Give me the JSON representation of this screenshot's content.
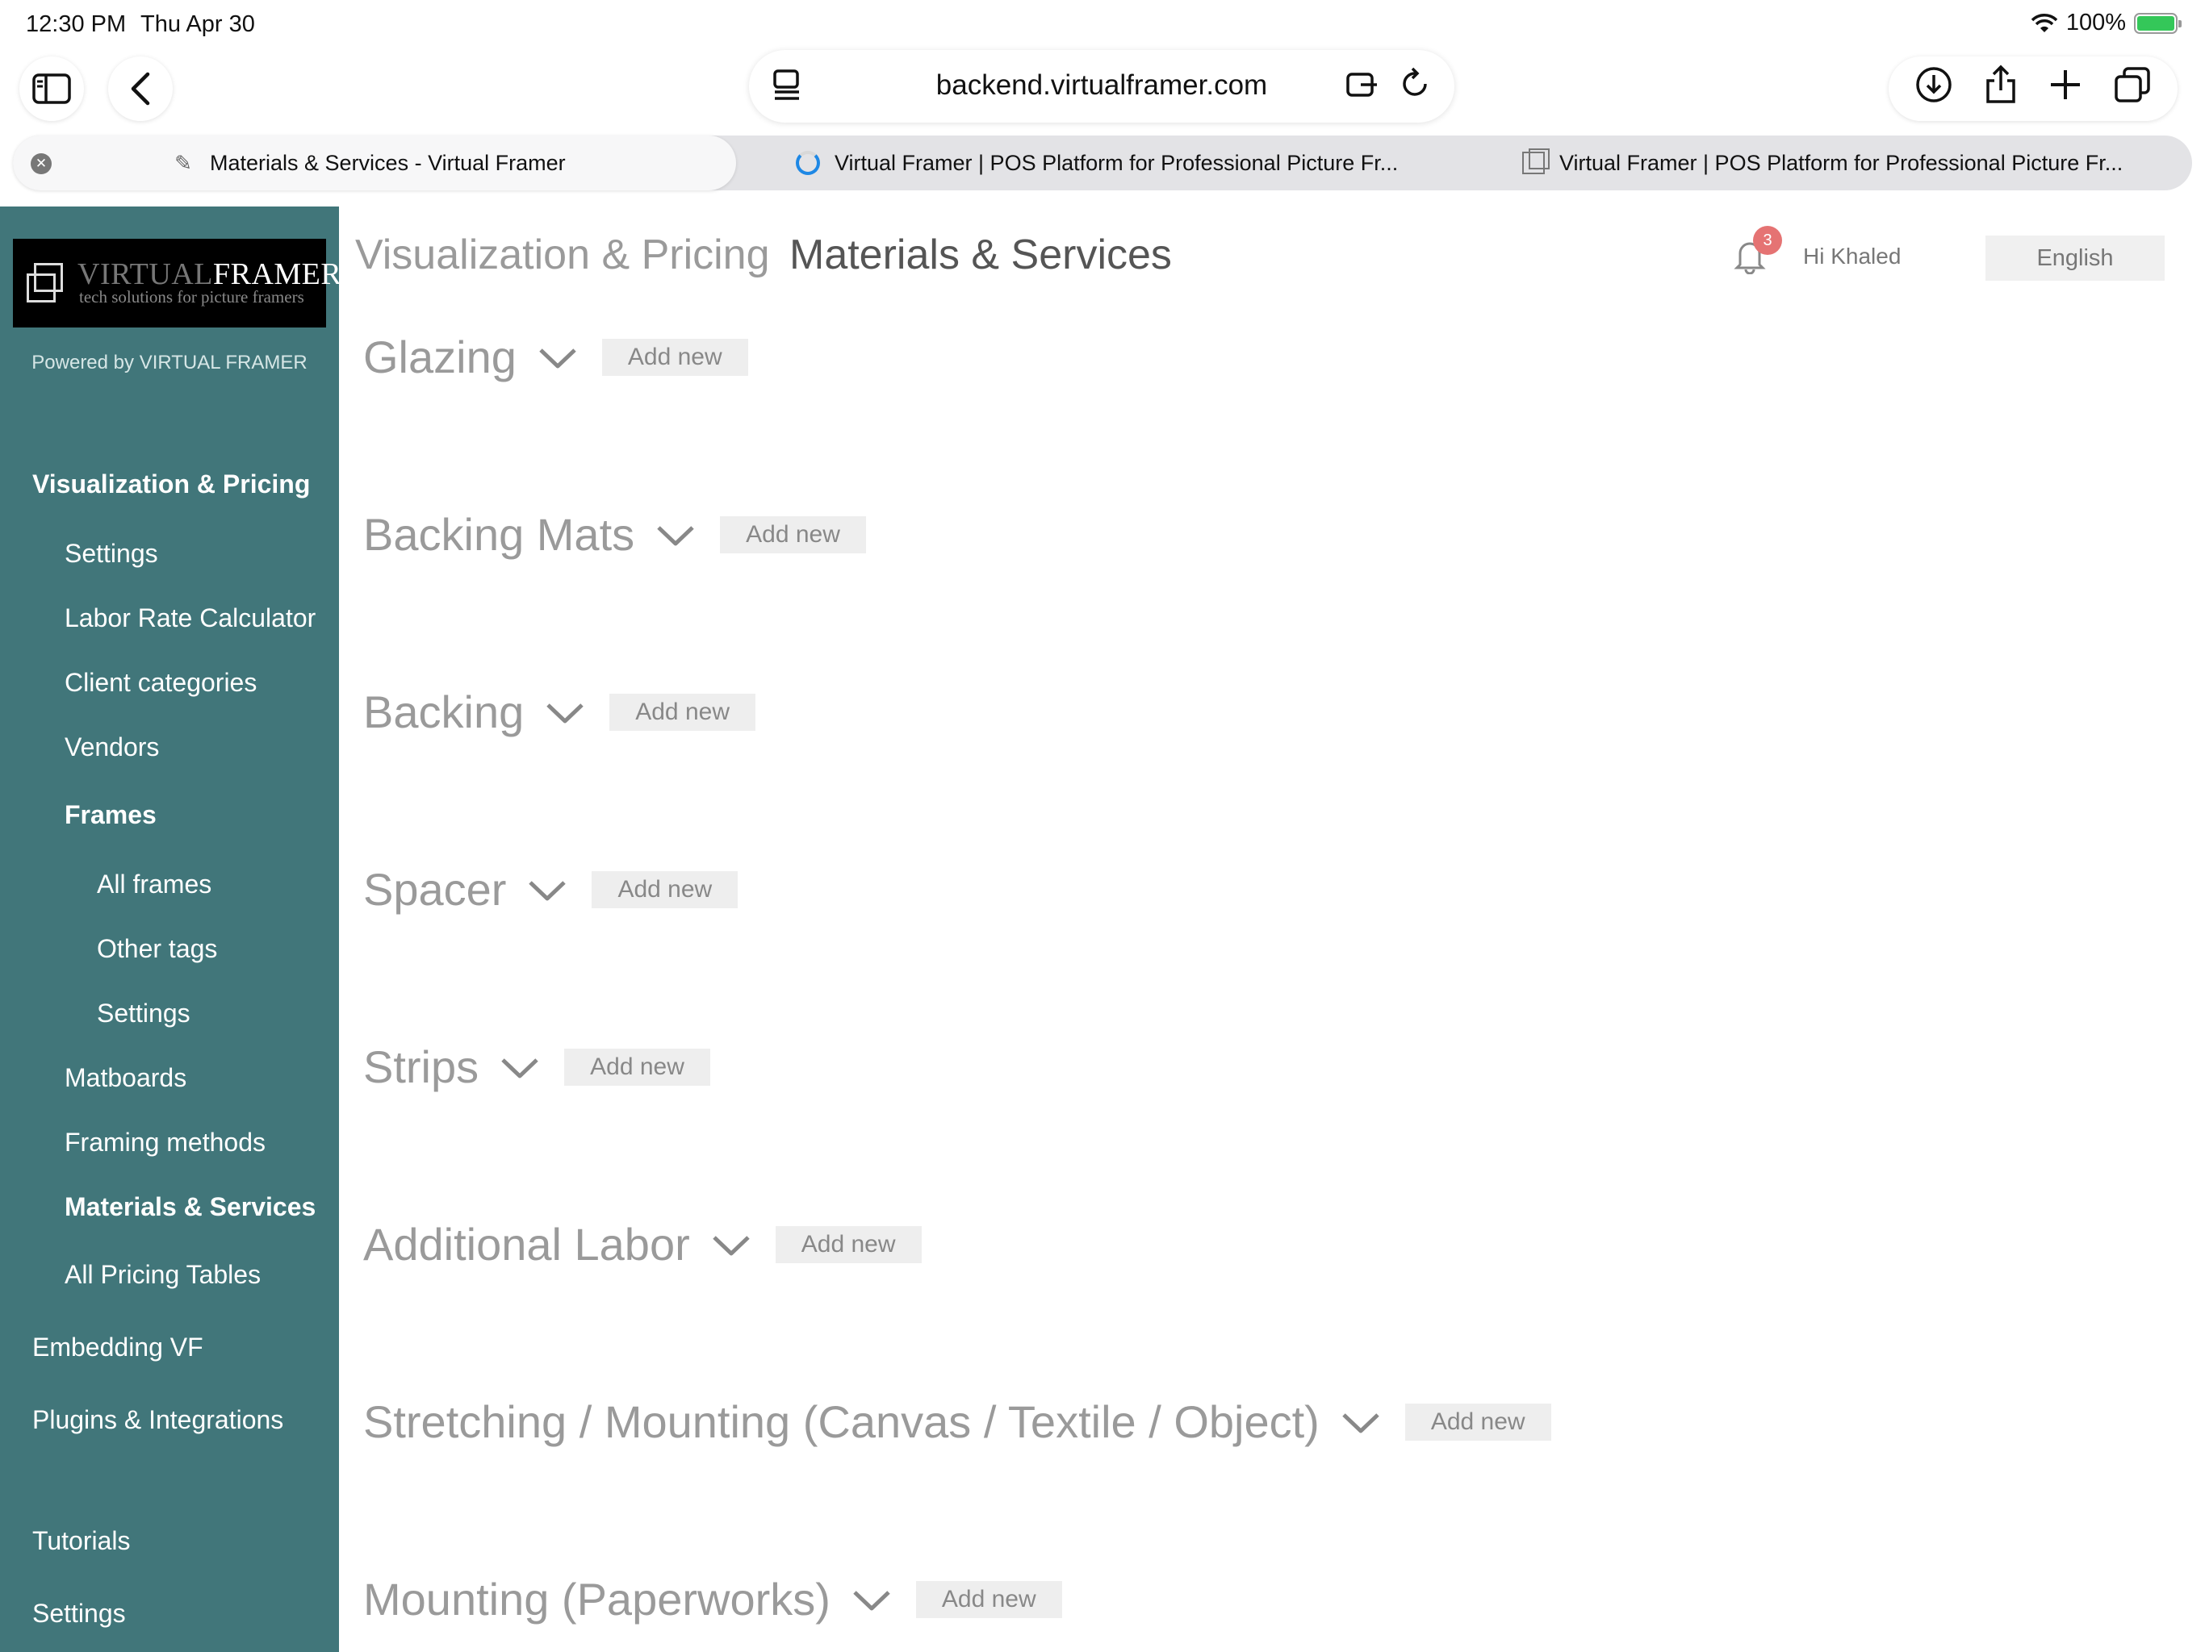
{
  "status_bar": {
    "time": "12:30 PM",
    "date": "Thu Apr 30",
    "battery": "100%"
  },
  "browser": {
    "url": "backend.virtualframer.com",
    "tabs": [
      {
        "title": "Materials & Services - Virtual Framer",
        "active": true
      },
      {
        "title": "Virtual Framer | POS Platform for Professional Picture Fr...",
        "loading": true
      },
      {
        "title": "Virtual Framer | POS Platform for Professional Picture Fr..."
      }
    ]
  },
  "sidebar": {
    "logo": {
      "name_thin": "VIRTUAL",
      "name_bold": "FRAMER",
      "tagline": "tech solutions for picture framers"
    },
    "powered_by": "Powered by VIRTUAL FRAMER",
    "items": [
      {
        "label": "Visualization & Pricing"
      },
      {
        "label": "Settings"
      },
      {
        "label": "Labor Rate Calculator"
      },
      {
        "label": "Client categories"
      },
      {
        "label": "Vendors"
      },
      {
        "label": "Frames"
      },
      {
        "label": "All frames"
      },
      {
        "label": "Other tags"
      },
      {
        "label": "Settings"
      },
      {
        "label": "Matboards"
      },
      {
        "label": "Framing methods"
      },
      {
        "label": "Materials & Services"
      },
      {
        "label": "All Pricing Tables"
      },
      {
        "label": "Embedding VF"
      },
      {
        "label": "Plugins & Integrations"
      },
      {
        "label": "Tutorials"
      },
      {
        "label": "Settings"
      }
    ]
  },
  "header": {
    "breadcrumb_parent": "Visualization & Pricing",
    "breadcrumb_current": "Materials & Services",
    "notification_count": "3",
    "greeting": "Hi Khaled",
    "language": "English"
  },
  "sections": [
    {
      "title": "Glazing",
      "add_label": "Add new"
    },
    {
      "title": "Backing Mats",
      "add_label": "Add new"
    },
    {
      "title": "Backing",
      "add_label": "Add new"
    },
    {
      "title": "Spacer",
      "add_label": "Add new"
    },
    {
      "title": "Strips",
      "add_label": "Add new"
    },
    {
      "title": "Additional Labor",
      "add_label": "Add new"
    },
    {
      "title": "Stretching / Mounting (Canvas / Textile / Object)",
      "add_label": "Add new"
    },
    {
      "title": "Mounting (Paperworks)",
      "add_label": "Add new"
    }
  ],
  "colors": {
    "sidebar_bg": "#41767a",
    "badge": "#e57373",
    "loading_spinner": "#1e88e5",
    "battery": "#34c759"
  }
}
